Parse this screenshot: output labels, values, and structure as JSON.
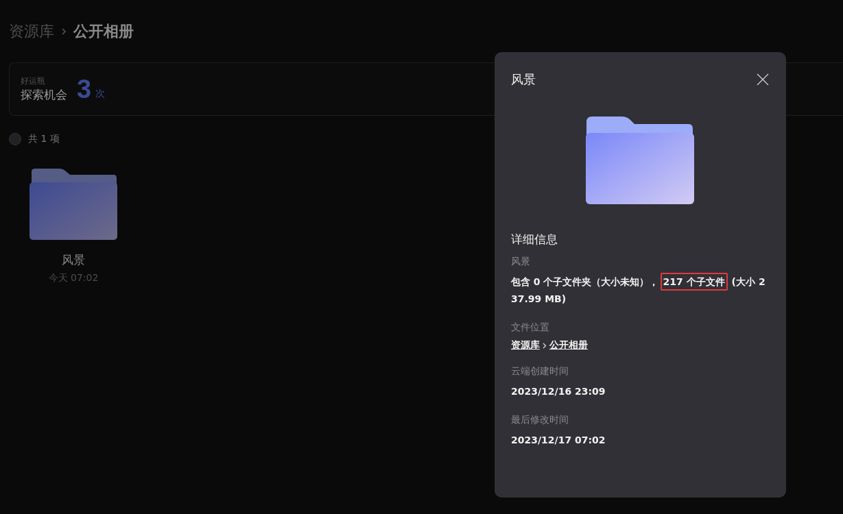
{
  "breadcrumb": [
    {
      "label": "资源库",
      "current": false
    },
    {
      "label": "公开相册",
      "current": true
    }
  ],
  "lucky_card": {
    "caption": "好运瓶",
    "label": "探索机会",
    "count": "3",
    "unit": "次"
  },
  "select_all": {
    "checked": false,
    "label": "共 1 项"
  },
  "items": [
    {
      "name": "风景",
      "time": "今天 07:02"
    }
  ],
  "details_panel": {
    "title": "风景",
    "section_title": "详细信息",
    "fields": [
      {
        "label": "风景",
        "kind": "text",
        "segments": [
          {
            "text": "包含 0 个子文件夹（大小未知），",
            "highlighted": false
          },
          {
            "text": "217 个子文件",
            "highlighted": true
          },
          {
            "text": "(大小 237.99 MB)",
            "highlighted": false
          }
        ]
      },
      {
        "label": "文件位置",
        "kind": "path",
        "path": [
          "资源库",
          "公开相册"
        ]
      },
      {
        "label": "云端创建时间",
        "kind": "plain",
        "value": "2023/12/16 23:09"
      },
      {
        "label": "最后修改时间",
        "kind": "plain",
        "value": "2023/12/17 07:02"
      }
    ]
  }
}
